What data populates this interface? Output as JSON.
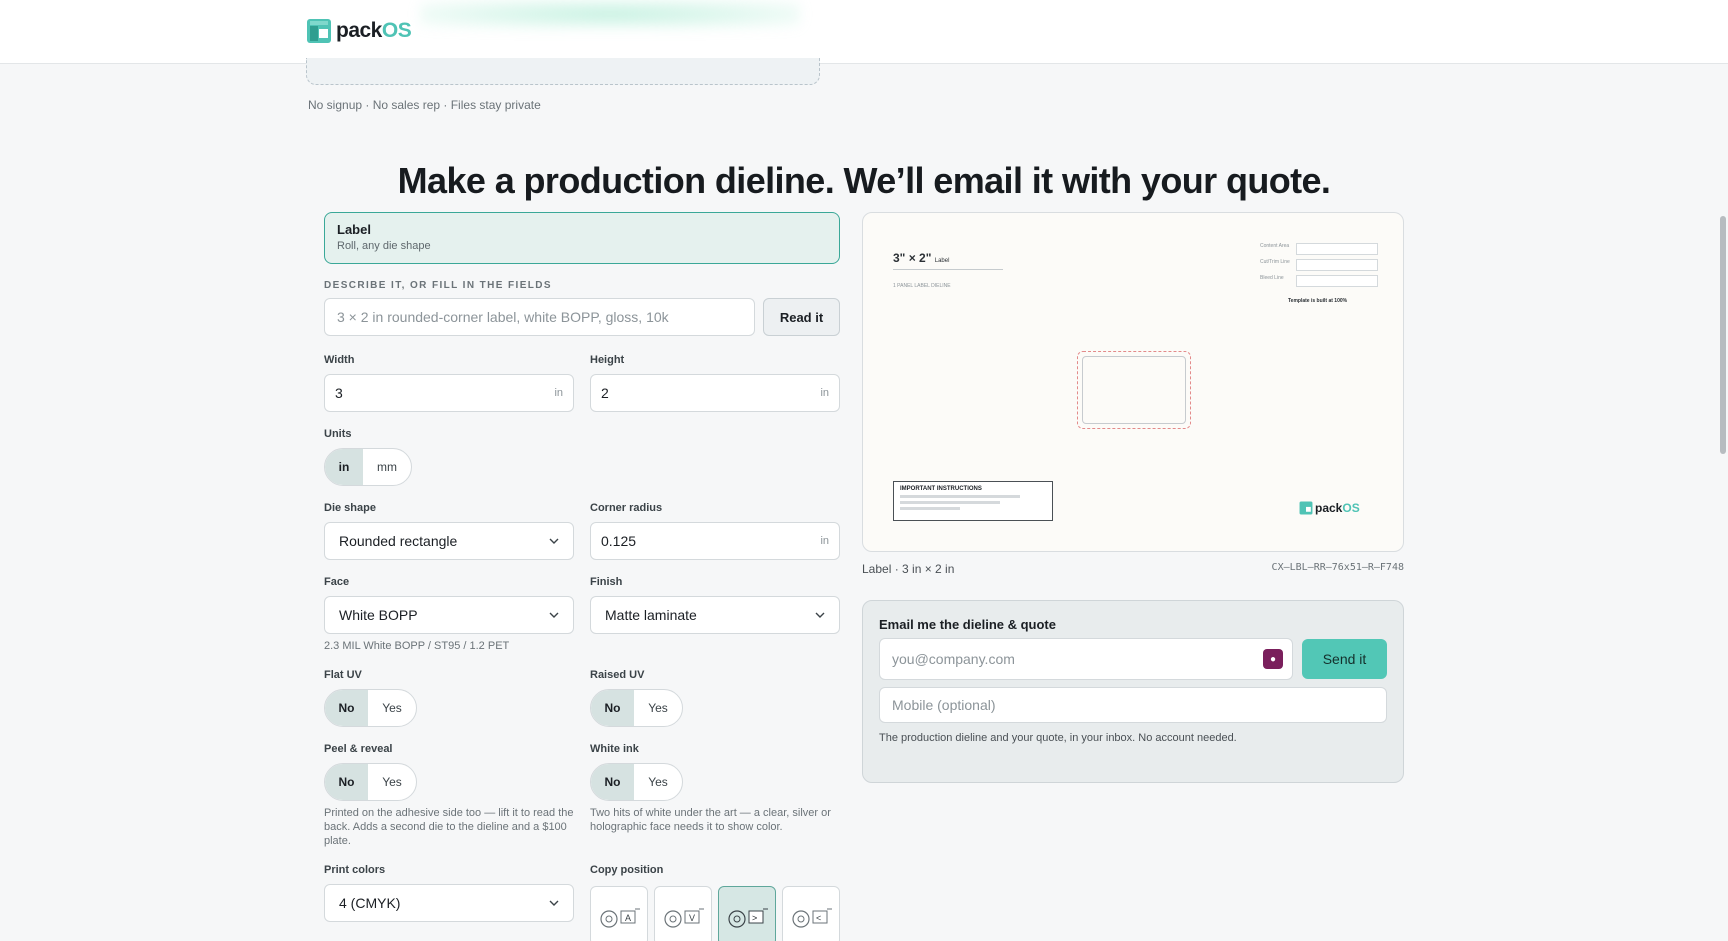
{
  "brand": {
    "name_part1": "pack",
    "name_part2": "OS",
    "accent": "#4fc3b5"
  },
  "upload": {
    "note": "No signup · No sales rep · Files stay private"
  },
  "headline": "Make a production dieline. We’ll email it with your quote.",
  "product_type": {
    "title": "Label",
    "subtitle": "Roll, any die shape"
  },
  "describe": {
    "section_label": "DESCRIBE IT, OR FILL IN THE FIELDS",
    "placeholder": "3 × 2 in rounded-corner label, white BOPP, gloss, 10k",
    "button": "Read it"
  },
  "fields": {
    "width": {
      "label": "Width",
      "value": "3",
      "unit": "in"
    },
    "height": {
      "label": "Height",
      "value": "2",
      "unit": "in"
    },
    "units": {
      "label": "Units",
      "options": [
        "in",
        "mm"
      ],
      "selected": "in"
    },
    "die_shape": {
      "label": "Die shape",
      "value": "Rounded rectangle"
    },
    "corner_radius": {
      "label": "Corner radius",
      "value": "0.125",
      "unit": "in"
    },
    "face": {
      "label": "Face",
      "value": "White BOPP",
      "hint": "2.3 MIL White BOPP / ST95 / 1.2 PET"
    },
    "finish": {
      "label": "Finish",
      "value": "Matte laminate"
    },
    "flat_uv": {
      "label": "Flat UV",
      "options": [
        "No",
        "Yes"
      ],
      "selected": "No"
    },
    "raised_uv": {
      "label": "Raised UV",
      "options": [
        "No",
        "Yes"
      ],
      "selected": "No"
    },
    "peel_reveal": {
      "label": "Peel & reveal",
      "options": [
        "No",
        "Yes"
      ],
      "selected": "No",
      "hint": "Printed on the adhesive side too — lift it to read the back. Adds a second die to the dieline and a $100 plate."
    },
    "white_ink": {
      "label": "White ink",
      "options": [
        "No",
        "Yes"
      ],
      "selected": "No",
      "hint": "Two hits of white under the art — a clear, silver or holographic face needs it to show color."
    },
    "print_colors": {
      "label": "Print colors",
      "value": "4 (CMYK)"
    },
    "copy_position": {
      "label": "Copy position",
      "options": [
        "A",
        "V",
        "up",
        "down"
      ],
      "selected_index": 2
    }
  },
  "preview": {
    "dim_title": "3\" × 2\"",
    "dim_suffix": "Label",
    "subtitle": "1 PANEL LABEL DIELINE",
    "notes": [
      "Content Area",
      "Cut/Trim Line",
      "Bleed Line"
    ],
    "built": "Template is built at 100%",
    "instructions_title": "IMPORTANT INSTRUCTIONS",
    "caption": "Label · 3 in × 2 in",
    "code": "CX–LBL–RR–76x51–R–F748"
  },
  "email": {
    "title": "Email me the dieline & quote",
    "email_placeholder": "you@company.com",
    "send_button": "Send it",
    "mobile_placeholder": "Mobile (optional)",
    "note": "The production dieline and your quote, in your inbox. No account needed."
  }
}
